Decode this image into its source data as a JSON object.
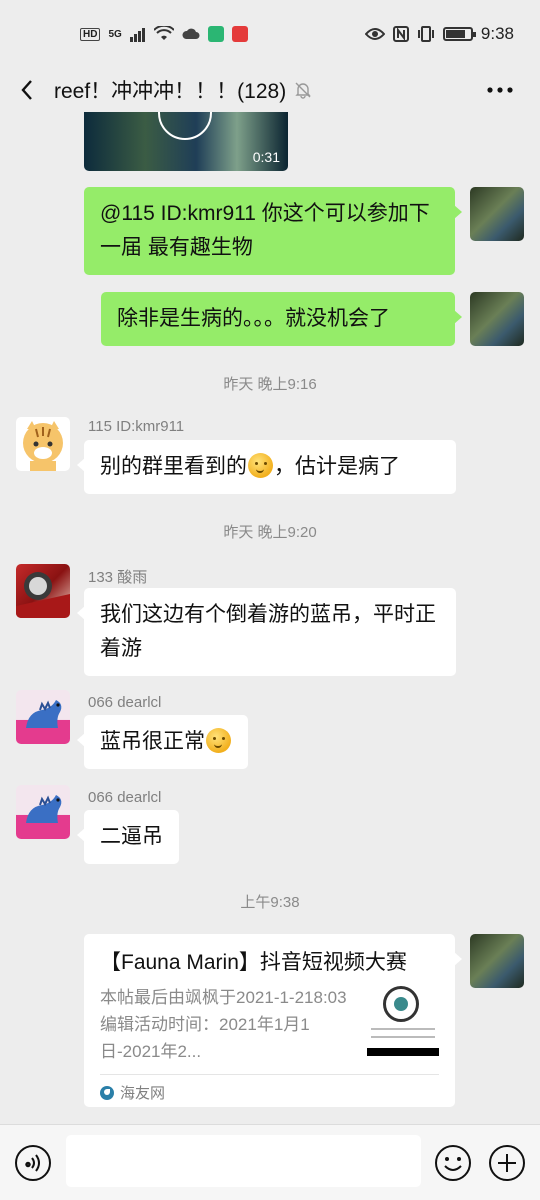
{
  "status_bar": {
    "left_badges": [
      "HD",
      "5G"
    ],
    "time": "9:38",
    "battery_level": 0.8
  },
  "header": {
    "title": "reef！冲冲冲！！！(128)"
  },
  "video": {
    "duration": "0:31"
  },
  "messages": [
    {
      "from": "me",
      "text": "@115 ID:kmr911  你这个可以参加下一届 最有趣生物"
    },
    {
      "from": "me",
      "text": "除非是生病的。。。就没机会了"
    },
    {
      "timestamp": "昨天 晚上9:16"
    },
    {
      "from": "115 ID:kmr911",
      "text_before": "别的群里看到的",
      "emoji": "thinking-emoji",
      "text_after": "，估计是病了"
    },
    {
      "timestamp": "昨天 晚上9:20"
    },
    {
      "from": "133  酸雨",
      "text": "我们这边有个倒着游的蓝吊，平时正着游"
    },
    {
      "from": "066 dearlcl",
      "text_before": "蓝吊很正常",
      "emoji": "thinking-emoji"
    },
    {
      "from": "066 dearlcl",
      "text": "二逼吊"
    },
    {
      "timestamp": "上午9:38"
    }
  ],
  "link_card": {
    "title": "【Fauna Marin】抖音短视频大赛",
    "description": "本帖最后由飒枫于2021-1-218:03编辑活动时间：2021年1月1日-2021年2...",
    "source": "海友网"
  },
  "input": {
    "placeholder": ""
  },
  "colors": {
    "green_bubble": "#95ec69",
    "background": "#ededed"
  }
}
